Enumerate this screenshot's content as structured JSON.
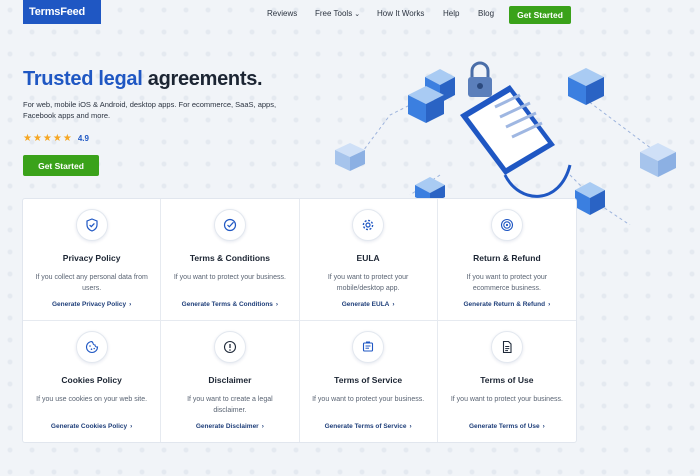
{
  "brand": {
    "logo": "TermsFeed"
  },
  "nav": {
    "items": [
      {
        "label": "Reviews"
      },
      {
        "label": "Free Tools",
        "chevron": "⌄"
      },
      {
        "label": "How It Works"
      },
      {
        "label": "Help"
      },
      {
        "label": "Blog"
      }
    ],
    "cta": "Get Started"
  },
  "hero": {
    "title_blue": "Trusted legal",
    "title_dark": " agreements.",
    "subtitle": "For web, mobile iOS & Android, desktop apps. For ecommerce, SaaS, apps, Facebook apps and more.",
    "stars": "★★★★★",
    "rating": "4.9",
    "cta": "Get Started"
  },
  "cards": [
    {
      "icon": "shield-check-icon",
      "title": "Privacy Policy",
      "desc": "If you collect any personal data from users.",
      "link": "Generate Privacy Policy"
    },
    {
      "icon": "check-circle-icon",
      "title": "Terms & Conditions",
      "desc": "If you want to protect your business.",
      "link": "Generate Terms & Conditions"
    },
    {
      "icon": "gear-icon",
      "title": "EULA",
      "desc": "If you want to protect your mobile/desktop app.",
      "link": "Generate EULA"
    },
    {
      "icon": "return-target-icon",
      "title": "Return & Refund",
      "desc": "If you want to protect your ecommerce business.",
      "link": "Generate Return & Refund"
    },
    {
      "icon": "cookie-icon",
      "title": "Cookies Policy",
      "desc": "If you use cookies on your web site.",
      "link": "Generate Cookies Policy"
    },
    {
      "icon": "alert-circle-icon",
      "title": "Disclaimer",
      "desc": "If you want to create a legal disclaimer.",
      "link": "Generate Disclaimer"
    },
    {
      "icon": "service-doc-icon",
      "title": "Terms of Service",
      "desc": "If you want to protect your business.",
      "link": "Generate Terms of Service"
    },
    {
      "icon": "document-icon",
      "title": "Terms of Use",
      "desc": "If you want to protect your business.",
      "link": "Generate Terms of Use"
    }
  ],
  "colors": {
    "brand_blue": "#1f57c3",
    "cta_green": "#3aa21a",
    "star": "#f5a623"
  }
}
